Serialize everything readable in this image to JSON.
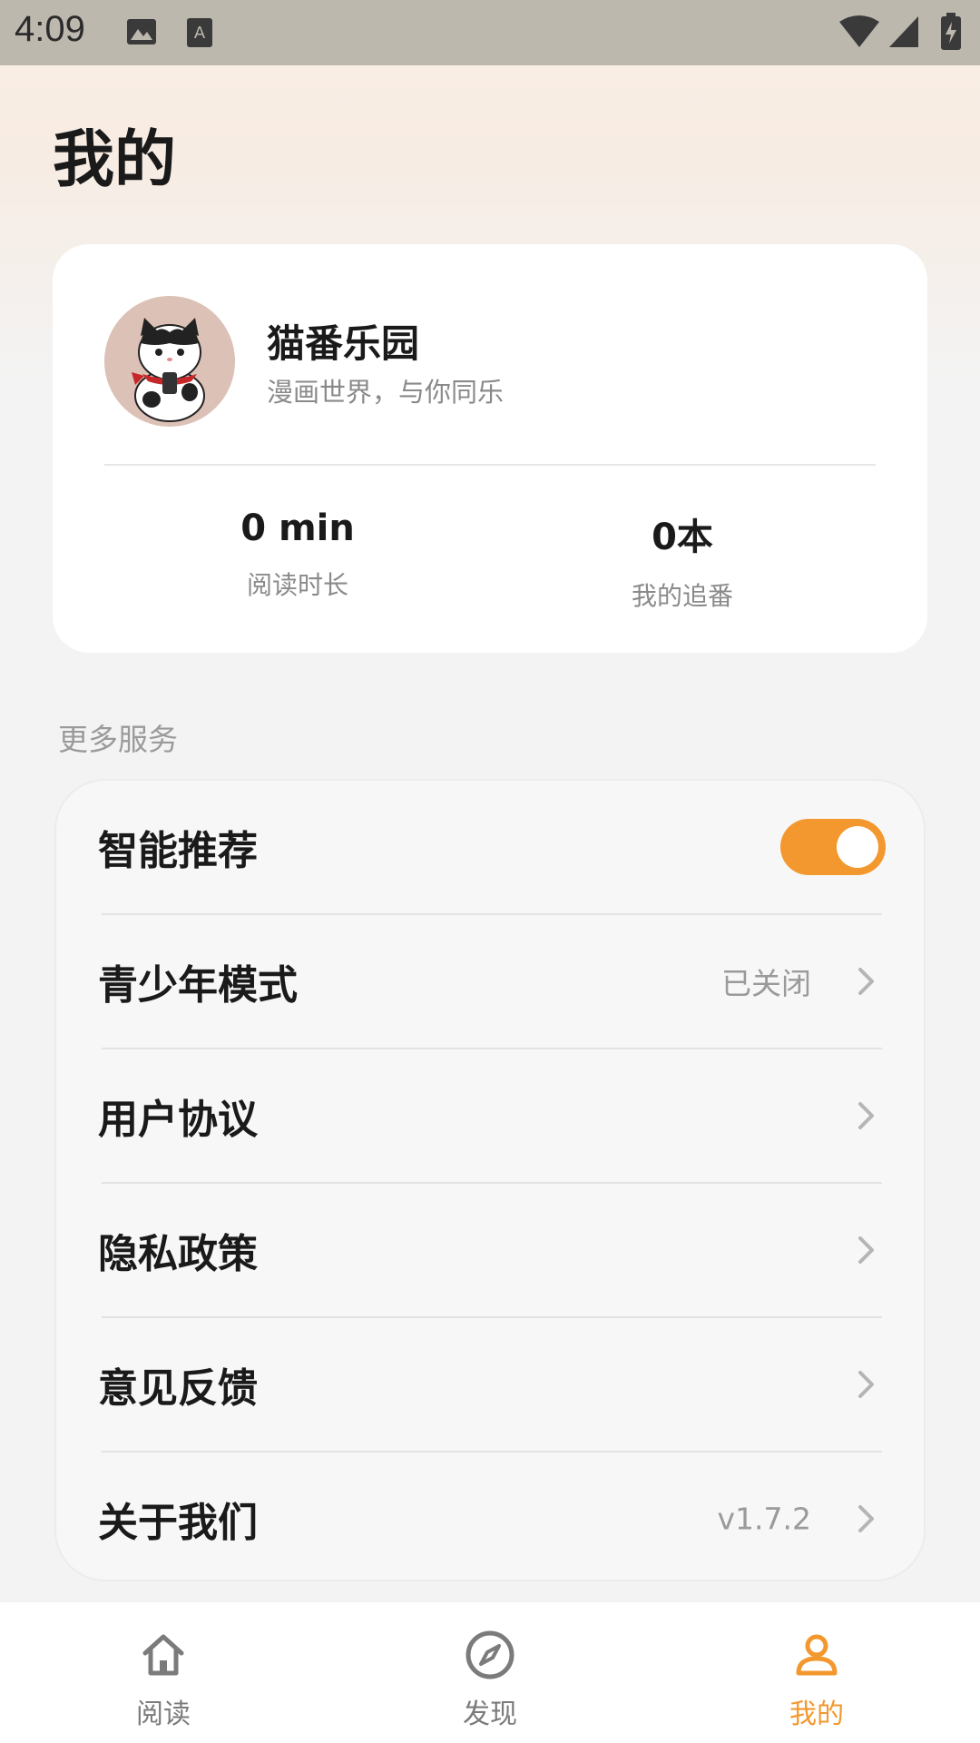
{
  "status_bar": {
    "time": "4:09"
  },
  "page": {
    "title": "我的"
  },
  "profile": {
    "name": "猫番乐园",
    "subtitle": "漫画世界，与你同乐",
    "stats": [
      {
        "value": "0 min",
        "label": "阅读时长"
      },
      {
        "value": "0本",
        "label": "我的追番"
      }
    ]
  },
  "services": {
    "section_title": "更多服务",
    "items": [
      {
        "label": "智能推荐",
        "toggle_on": true
      },
      {
        "label": "青少年模式",
        "value": "已关闭"
      },
      {
        "label": "用户协议"
      },
      {
        "label": "隐私政策"
      },
      {
        "label": "意见反馈"
      },
      {
        "label": "关于我们",
        "value": "v1.7.2"
      }
    ]
  },
  "bottom_nav": {
    "items": [
      {
        "label": "阅读",
        "icon": "home-icon",
        "active": false
      },
      {
        "label": "发现",
        "icon": "compass-icon",
        "active": false
      },
      {
        "label": "我的",
        "icon": "user-icon",
        "active": true
      }
    ]
  },
  "colors": {
    "accent": "#f3982e",
    "text_primary": "#1a1a1a",
    "text_secondary": "#8a8a8a"
  }
}
